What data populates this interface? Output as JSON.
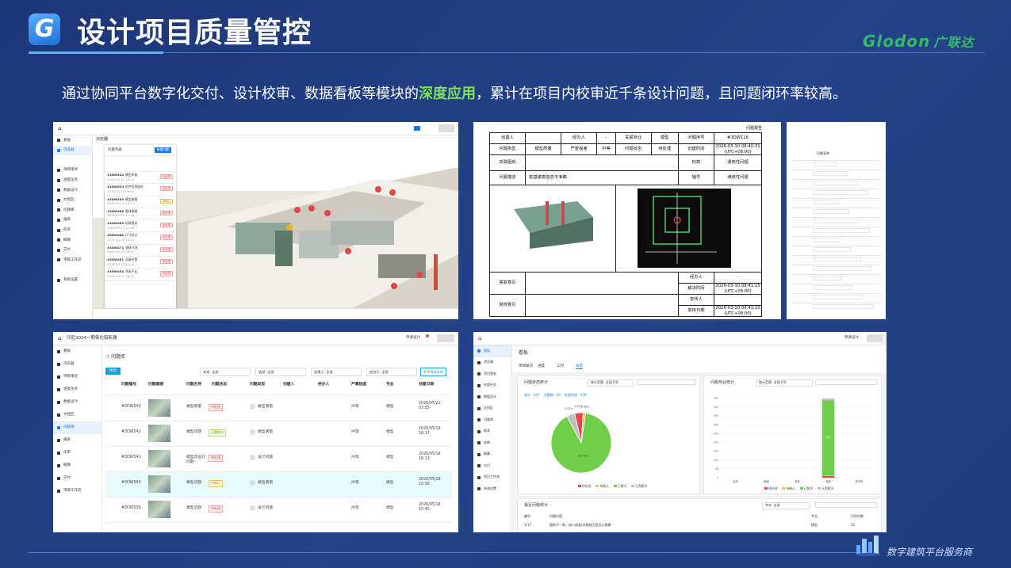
{
  "header": {
    "logo_letter": "G",
    "title": "设计项目质量管控",
    "brand_latin": "Glodon",
    "brand_cn": "广联达"
  },
  "intro": {
    "before": "通过协同平台数字化交付、设计校审、数据看板等模块的",
    "highlight": "深度应用",
    "after": "，累计在项目内校审近千条设计问题，且问题闭环率较高。"
  },
  "footer": {
    "tagline": "数字建筑平台服务商"
  },
  "colors": {
    "accent_green": "#7fe05a",
    "brand_green": "#35b86b",
    "primary_blue": "#1677ff",
    "pie_green": "#6fcf4a",
    "pie_red": "#e34848"
  },
  "shot1": {
    "tab_label": "浏览器",
    "panel_title": "问题列表",
    "panel_button": "新建问题",
    "nav": [
      "看板",
      "浏览器",
      "",
      "项目策划",
      "进度任务",
      "数据设计",
      "文档区",
      "问题库",
      "报表",
      "校审",
      "概算",
      "交付",
      "项目工作流",
      "",
      "系统设置"
    ],
    "issues": [
      {
        "id": "#3DW543",
        "title": "模型质量",
        "status": "待处理",
        "date": "2026-05-22 10:23"
      },
      {
        "id": "#3DW533",
        "title": "构件信息缺失",
        "status": "待处理",
        "date": "2026-05-19 09:57"
      },
      {
        "id": "#3DW489",
        "title": "模型碰撞",
        "status": "待确认",
        "date": "2026-05-11 10:32"
      },
      {
        "id": "#3DW488",
        "title": "管线碰撞",
        "status": "待处理",
        "date": "2026-05-11 11:48"
      },
      {
        "id": "#3DW483",
        "title": "标高错误",
        "status": "待处理",
        "date": "2026-05-11 11:06"
      },
      {
        "id": "#3DW480",
        "title": "尺寸标注",
        "status": "待处理",
        "date": "2026-04-28 10:12"
      },
      {
        "id": "#3DW471",
        "title": "墙体开洞",
        "status": "待处理",
        "date": "2026-04-28 09:50"
      },
      {
        "id": "#3DW461",
        "title": "设备布置",
        "status": "待处理",
        "date": "2026-04-22 10:04"
      },
      {
        "id": "#3DW454",
        "title": "净高不足",
        "status": "待处理",
        "date": "2026-04-20 16:11"
      }
    ]
  },
  "shot2": {
    "heading": "问题报告",
    "rows": [
      [
        "创建人",
        "",
        "经办人",
        "-",
        "关联专业",
        "模型",
        "问题序号",
        "#3DW116"
      ],
      [
        "问题类型",
        "模型质量",
        "严重程度",
        "中等",
        "问题状态",
        "待处理",
        "创建时间",
        "2026-03-10 08:40:31 (UTC+08:00)"
      ]
    ],
    "linked_label": "关联图纸",
    "linked_tag_label": "标高",
    "linked_tag_value": "通用性问题",
    "desc_label": "问题描述",
    "desc_value": "桩基建模信息不准确",
    "axis_label": "轴号",
    "axis_value": "通用性问题",
    "reply_label": "答复意见",
    "review_label": "复核意见",
    "handler_label": "经办人",
    "handler_value": "-",
    "resolve_label": "解决时间",
    "resolve_value": "2026-03-10 08:41:15 (UTC+08:00)",
    "reviewer_label": "复核人",
    "review_date_label": "复核日期",
    "review_date_value": "2026-03-10 08:41:15 (UTC+08:00)"
  },
  "shot3": {
    "title": "问题表单"
  },
  "shot4": {
    "project": "印尼2024一期氧化铝新建",
    "page_title": "问题库",
    "user": "申请设计",
    "export_button": "导出",
    "filters": [
      "状态: 全部",
      "类型: 全部",
      "创建人: 全部",
      "经办人: 全部"
    ],
    "more_filter": "更多筛选条件",
    "nav": [
      "看板",
      "浏览器",
      "项目策划",
      "进度任务",
      "数据设计",
      "文档区",
      "问题库",
      "报表",
      "校审",
      "概算",
      "交付",
      "项目工作流"
    ],
    "columns": [
      "问题编号",
      "问题截图",
      "问题名称",
      "问题状态",
      "问题类型",
      "创建人",
      "经办人",
      "严重程度",
      "专业",
      "创建日期"
    ],
    "rows": [
      {
        "id": "#3DW543",
        "name": "模型质量",
        "status": "待处理",
        "type": "模型质量",
        "severity": "中等",
        "discipline": "模型",
        "date": "2026/05/22 07:55"
      },
      {
        "id": "#3DW542",
        "name": "模型问题",
        "status": "无需解决",
        "type": "模型质量",
        "severity": "中等",
        "discipline": "模型",
        "date": "2026/05/18 16:17"
      },
      {
        "id": "#3DW541",
        "name": "模型及设计问题",
        "status": "待处理",
        "type": "设计问题",
        "severity": "中等",
        "discipline": "模型",
        "date": "2026/05/18 16:13"
      },
      {
        "id": "#3DW540",
        "name": "模型问题",
        "status": "待确认",
        "type": "模型质量",
        "severity": "中等",
        "discipline": "模型",
        "date": "2026/05/18 15:56"
      },
      {
        "id": "#3DW539",
        "name": "模型问题",
        "status": "待处理",
        "type": "设计问题",
        "severity": "中等",
        "discipline": "模型",
        "date": "2026/05/18 15:45"
      }
    ]
  },
  "shot5": {
    "page_title": "看板",
    "user": "申请设计",
    "tabs": [
      "项目概况",
      "进度",
      "工时",
      "质量"
    ],
    "nav": [
      "看板",
      "浏览器",
      "项目策划",
      "进度任务",
      "数据设计",
      "文档区",
      "问题库",
      "报表",
      "校审",
      "概算",
      "交付",
      "项目工作流",
      "系统设置"
    ],
    "left_card_title": "问题状态统计",
    "left_filter": "统计范围: 全部子项",
    "summary": "统计：507    问题数：29    处理完成：478",
    "right_card_title": "问题专业统计",
    "right_filter": "统计范围: 全部子项",
    "legend": [
      "待处理",
      "待确认",
      "已解决",
      "无需解决"
    ],
    "bottom_card_title": "最近问题统计",
    "bottom_filter": "专业: 全部",
    "bottom_columns": [
      "编号",
      "问题内容",
      "专业",
      "引用次数"
    ],
    "bottom_row": [
      "1/17",
      "图纸不一致，缺少剖面/未按施工图设计建模",
      "模型",
      "12"
    ]
  },
  "chart_data": [
    {
      "type": "pie",
      "labels": [
        "待处理",
        "待确认",
        "已解决",
        "无需解决"
      ],
      "values": [
        4.54,
        1.38,
        89.44,
        4.34
      ],
      "slice_labels": [
        "4.54%",
        "1.38%",
        "89.44%",
        "4.34%"
      ],
      "colors": [
        "#e34848",
        "#f0c05b",
        "#6fcf4a",
        "#bdbdbd"
      ]
    },
    {
      "type": "bar",
      "categories": [
        "结构",
        "暖通",
        "给排",
        "模型",
        "表示制"
      ],
      "series": [
        {
          "name": "待处理",
          "values": [
            0,
            0,
            0,
            10,
            0
          ]
        },
        {
          "name": "待确认",
          "values": [
            0,
            0,
            0,
            2,
            0
          ]
        },
        {
          "name": "已解决",
          "values": [
            0,
            0,
            0,
            427,
            0
          ]
        },
        {
          "name": "无需解决",
          "values": [
            0,
            0,
            0,
            10,
            0
          ]
        }
      ],
      "ylim": [
        0,
        450
      ],
      "yticks": [
        0,
        50,
        100,
        150,
        200,
        250,
        300,
        350,
        400,
        450
      ],
      "bar_label": "427"
    }
  ]
}
